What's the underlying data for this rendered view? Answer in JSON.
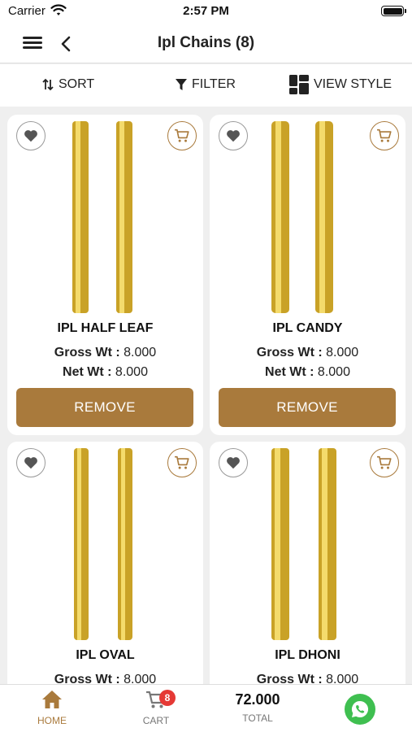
{
  "status_bar": {
    "carrier": "Carrier",
    "time": "2:57 PM"
  },
  "nav": {
    "title": "Ipl Chains (8)"
  },
  "toolbar": {
    "sort_label": "SORT",
    "filter_label": "FILTER",
    "view_style_label": "VIEW STYLE"
  },
  "products": [
    {
      "name": "IPL HALF LEAF",
      "gross_label": "Gross Wt :",
      "gross_value": "8.000",
      "net_label": "Net Wt :",
      "net_value": "8.000",
      "action_label": "REMOVE"
    },
    {
      "name": "IPL CANDY",
      "gross_label": "Gross Wt :",
      "gross_value": "8.000",
      "net_label": "Net Wt :",
      "net_value": "8.000",
      "action_label": "REMOVE"
    },
    {
      "name": "IPL OVAL",
      "gross_label": "Gross Wt :",
      "gross_value": "8.000"
    },
    {
      "name": "IPL DHONI",
      "gross_label": "Gross Wt :",
      "gross_value": "8.000"
    }
  ],
  "tab_bar": {
    "home_label": "HOME",
    "cart_label": "CART",
    "cart_count": "8",
    "total_value": "72.000",
    "total_label": "TOTAL"
  },
  "colors": {
    "accent": "#a97a3c",
    "badge": "#e53935",
    "whatsapp": "#3fbf50",
    "gold": "#d9b02f"
  }
}
